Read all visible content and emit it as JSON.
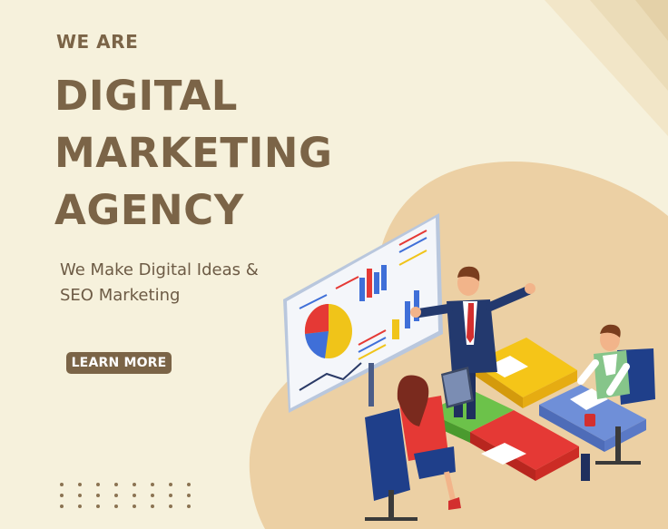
{
  "hero": {
    "eyebrow": "WE ARE",
    "headline": [
      "DIGITAL",
      "MARKETING",
      "AGENCY"
    ],
    "tagline": [
      "We Make Digital Ideas &",
      "SEO Marketing"
    ],
    "cta_label": "LEARN MORE"
  },
  "colors": {
    "background": "#f6f1dc",
    "accent_brown": "#7b6447",
    "blob_tan": "#ecd0a4"
  },
  "illustration": {
    "icon": "business-team-meeting-illustration"
  }
}
